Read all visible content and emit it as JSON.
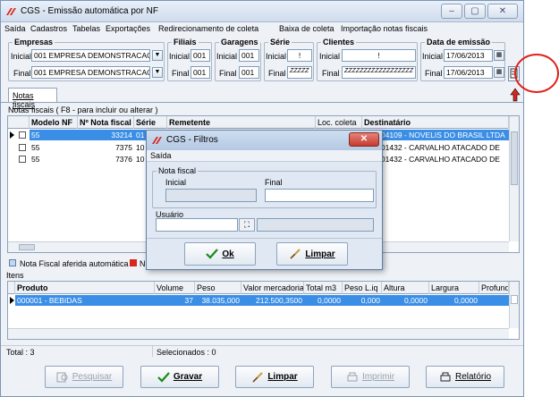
{
  "window": {
    "title": "CGS - Emissão automática por NF",
    "btn_min": "–",
    "btn_max": "▢",
    "btn_close": "✕"
  },
  "menu": [
    "Saída",
    "Cadastros",
    "Tabelas",
    "Exportações",
    "Redirecionamento de coleta",
    "Baixa de coleta",
    "Importação notas fiscais"
  ],
  "filters": {
    "empresas": {
      "label": "Empresas",
      "inicial_label": "Inicial",
      "final_label": "Final",
      "inicial": "001 EMPRESA DEMONSTRACAO",
      "final": "001 EMPRESA DEMONSTRACAO"
    },
    "filiais": {
      "label": "Filiais",
      "inicial_label": "Inicial",
      "final_label": "Final",
      "inicial": "001",
      "final": "001"
    },
    "garagens": {
      "label": "Garagens",
      "inicial_label": "Inicial",
      "final_label": "Final",
      "inicial": "001",
      "final": "001"
    },
    "serie": {
      "label": "Série",
      "inicial_label": "Inicial",
      "final_label": "Final",
      "inicial": "!",
      "final": "ZZZZZ"
    },
    "clientes": {
      "label": "Clientes",
      "inicial_label": "Inicial",
      "final_label": "Final",
      "inicial": "!",
      "final": "ZZZZZZZZZZZZZZZZZZ"
    },
    "data": {
      "label": "Data de emissão",
      "inicial_label": "Inicial",
      "final_label": "Final",
      "inicial": "17/06/2013",
      "final": "17/06/2013"
    }
  },
  "tab_label": "Notas fiscais",
  "notas": {
    "hint": "Notas fiscais ( F8 - para incluir ou alterar )",
    "columns": [
      "Modelo NF",
      "Nº Nota fiscal",
      "Série",
      "Remetente",
      "Loc. coleta",
      "Destinatário"
    ],
    "rows": [
      {
        "modelo": "55",
        "numero": "33214",
        "serie": "01",
        "destinatario": "200004109 - NOVELIS DO BRASIL LTDA"
      },
      {
        "modelo": "55",
        "numero": "7375",
        "serie": "10",
        "destinatario": "523001432 - CARVALHO ATACADO DE"
      },
      {
        "modelo": "55",
        "numero": "7376",
        "serie": "10",
        "destinatario": "523001432 - CARVALHO ATACADO DE"
      }
    ]
  },
  "legend": {
    "item1": "Nota Fiscal aferida automática",
    "item2": "N"
  },
  "itens": {
    "label": "Itens",
    "columns": [
      "Produto",
      "Volume",
      "Peso",
      "Valor mercadoria",
      "Total m3",
      "Peso L.iq",
      "Altura",
      "Largura",
      "Profundi"
    ],
    "rows": [
      {
        "produto": "000001 - BEBIDAS",
        "volume": "37",
        "peso": "38.035,000",
        "valor": "212.500,3500",
        "total_m3": "0,0000",
        "peso_liq": "0,000",
        "altura": "0,0000",
        "largura": "0,0000"
      }
    ]
  },
  "status": {
    "total": "Total : 3",
    "selecionados": "Selecionados : 0"
  },
  "buttons": {
    "pesquisar": "Pesquisar",
    "gravar": "Gravar",
    "limpar": "Limpar",
    "imprimir": "Imprimir",
    "relatorio": "Relatório"
  },
  "dialog": {
    "title": "CGS - Filtros",
    "menu": "Saída",
    "group": "Nota fiscal",
    "inicial_label": "Inicial",
    "final_label": "Final",
    "usuario_label": "Usuário",
    "ok": "Ok",
    "limpar": "Limpar"
  }
}
